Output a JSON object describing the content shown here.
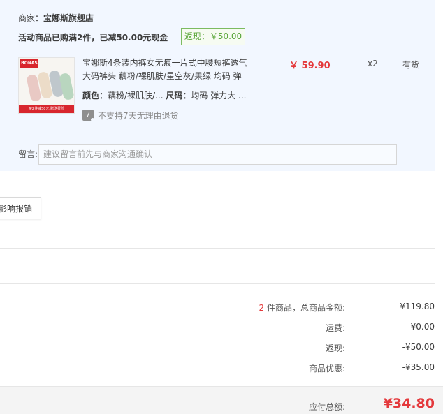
{
  "merchant": {
    "label": "商家：",
    "name": "宝娜斯旗舰店",
    "promo_text": "活动商品已购满2件，已减50.00元现金",
    "cashback_badge": "返现：￥50.00"
  },
  "product": {
    "thumbnail_logo": "BONAS",
    "thumbnail_banner": "买2件减50元 赠送费险",
    "title": "宝娜斯4条装内裤女无痕一片式中腰短裤透气大码裤头 藕粉/裸肌肤/星空灰/果绿 均码 弹",
    "color_label": "颜色：",
    "color_value": "藕粉/裸肌肤/...",
    "size_label": "尺码：",
    "size_value": "均码 弹力大 ...",
    "return_icon_text": "7",
    "return_policy": "不支持7天无理由退货",
    "price": "￥ 59.90",
    "quantity": "x2",
    "stock": "有货"
  },
  "remark": {
    "label": "留言:",
    "placeholder": "建议留言前先与商家沟通确认",
    "value": ""
  },
  "invoice": {
    "button_label": "影响报销"
  },
  "summary": {
    "items_count": "2",
    "items_label": " 件商品，总商品金额:",
    "items_amount": "¥119.80",
    "shipping_label": "运费:",
    "shipping_amount": "¥0.00",
    "cashback_label": "返现:",
    "cashback_amount": "-¥50.00",
    "discount_label": "商品优惠:",
    "discount_amount": "-¥35.00"
  },
  "total": {
    "label": "应付总额:",
    "amount": "¥34.80"
  },
  "colors": {
    "panel_bg": "#f2f7ff",
    "price_red": "#e4393c",
    "badge_green": "#5aa63a"
  },
  "icons": {
    "return_policy": "seven-day-return-icon"
  }
}
